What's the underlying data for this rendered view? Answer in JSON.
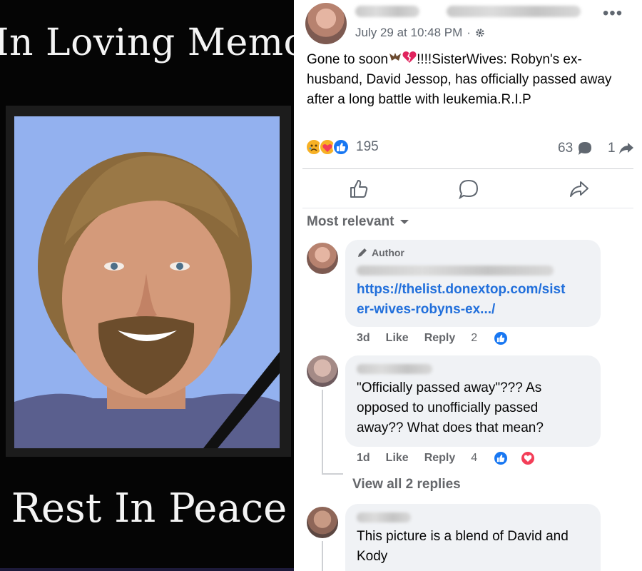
{
  "memorial": {
    "header": "In Loving Memory",
    "footer": "Rest In Peace"
  },
  "post": {
    "timestamp": "July 29 at 10:48 PM",
    "separator": "·",
    "privacy_icon": "gear-icon",
    "more_label": "•••",
    "text_part1": "Gone to soon",
    "text_part2": "!!!!SisterWives: Robyn's ex-husband, David Jessop, has officially passed away after a long battle with leukemia.R.I.P",
    "reaction_count": "195",
    "comment_count": "63",
    "share_count": "1",
    "reactions": [
      "sad-reaction-icon",
      "care-reaction-icon",
      "like-reaction-icon"
    ]
  },
  "comments_section": {
    "sort_label": "Most relevant"
  },
  "comments": [
    {
      "badge": "Author",
      "link": "https://thelist.donextop.com/sister-wives-robyns-ex.../",
      "link_line1": "https://thelist.donextop.com/sist",
      "link_line2": "er-wives-robyns-ex.../",
      "time": "3d",
      "like": "Like",
      "reply": "Reply",
      "reaction_count": "2"
    },
    {
      "text": "\"Officially passed away\"??? As opposed to unofficially passed away?? What does that mean?",
      "time": "1d",
      "like": "Like",
      "reply": "Reply",
      "reaction_count": "4"
    },
    {
      "text": "This picture is a blend of David and Kody"
    }
  ],
  "view_replies": "View all 2 replies",
  "colors": {
    "facebook_blue": "#1877f2",
    "link_blue": "#216fdb",
    "bubble_gray": "#f0f2f5",
    "meta_gray": "#65676b",
    "love_red": "#f33e58"
  }
}
